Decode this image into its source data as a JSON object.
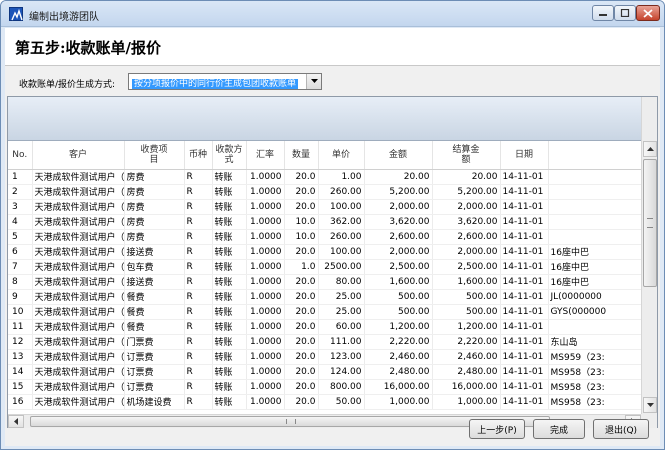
{
  "window": {
    "title": "编制出境游团队"
  },
  "header": {
    "step_title": "第五步:收款账单/报价"
  },
  "mode": {
    "label": "收款账单/报价生成方式:",
    "selected": "按分项报价中的同行价生成包团收款账单"
  },
  "table": {
    "columns": [
      "No.",
      "客户",
      "收费项目",
      "币种",
      "收款方式",
      "汇率",
      "数量",
      "单价",
      "金额",
      "结算金额",
      "日期",
      ""
    ],
    "rows": [
      [
        "1",
        "天港成软件测试用户（订阅者",
        "房费",
        "R",
        "转账",
        "1.0000",
        "20.0",
        "1.00",
        "20.00",
        "20.00",
        "14-11-01",
        ""
      ],
      [
        "2",
        "天港成软件测试用户（订阅者",
        "房费",
        "R",
        "转账",
        "1.0000",
        "20.0",
        "260.00",
        "5,200.00",
        "5,200.00",
        "14-11-01",
        ""
      ],
      [
        "3",
        "天港成软件测试用户（订阅者",
        "房费",
        "R",
        "转账",
        "1.0000",
        "20.0",
        "100.00",
        "2,000.00",
        "2,000.00",
        "14-11-01",
        ""
      ],
      [
        "4",
        "天港成软件测试用户（订阅者",
        "房费",
        "R",
        "转账",
        "1.0000",
        "10.0",
        "362.00",
        "3,620.00",
        "3,620.00",
        "14-11-01",
        ""
      ],
      [
        "5",
        "天港成软件测试用户（订阅者",
        "房费",
        "R",
        "转账",
        "1.0000",
        "10.0",
        "260.00",
        "2,600.00",
        "2,600.00",
        "14-11-01",
        ""
      ],
      [
        "6",
        "天港成软件测试用户（订阅者",
        "接送费",
        "R",
        "转账",
        "1.0000",
        "20.0",
        "100.00",
        "2,000.00",
        "2,000.00",
        "14-11-01",
        "16座中巴"
      ],
      [
        "7",
        "天港成软件测试用户（订阅者",
        "包车费",
        "R",
        "转账",
        "1.0000",
        "1.0",
        "2500.00",
        "2,500.00",
        "2,500.00",
        "14-11-01",
        "16座中巴"
      ],
      [
        "8",
        "天港成软件测试用户（订阅者",
        "接送费",
        "R",
        "转账",
        "1.0000",
        "20.0",
        "80.00",
        "1,600.00",
        "1,600.00",
        "14-11-01",
        "16座中巴"
      ],
      [
        "9",
        "天港成软件测试用户（订阅者",
        "餐费",
        "R",
        "转账",
        "1.0000",
        "20.0",
        "25.00",
        "500.00",
        "500.00",
        "14-11-01",
        "JL(0000000"
      ],
      [
        "10",
        "天港成软件测试用户（订阅者",
        "餐费",
        "R",
        "转账",
        "1.0000",
        "20.0",
        "25.00",
        "500.00",
        "500.00",
        "14-11-01",
        "GYS(000000"
      ],
      [
        "11",
        "天港成软件测试用户（订阅者",
        "餐费",
        "R",
        "转账",
        "1.0000",
        "20.0",
        "60.00",
        "1,200.00",
        "1,200.00",
        "14-11-01",
        ""
      ],
      [
        "12",
        "天港成软件测试用户（订阅者",
        "门票费",
        "R",
        "转账",
        "1.0000",
        "20.0",
        "111.00",
        "2,220.00",
        "2,220.00",
        "14-11-01",
        "东山岛"
      ],
      [
        "13",
        "天港成软件测试用户（订阅者",
        "订票费",
        "R",
        "转账",
        "1.0000",
        "20.0",
        "123.00",
        "2,460.00",
        "2,460.00",
        "14-11-01",
        "MS959（23:"
      ],
      [
        "14",
        "天港成软件测试用户（订阅者",
        "订票费",
        "R",
        "转账",
        "1.0000",
        "20.0",
        "124.00",
        "2,480.00",
        "2,480.00",
        "14-11-01",
        "MS958（23:"
      ],
      [
        "15",
        "天港成软件测试用户（订阅者",
        "订票费",
        "R",
        "转账",
        "1.0000",
        "20.0",
        "800.00",
        "16,000.00",
        "16,000.00",
        "14-11-01",
        "MS958（23:"
      ],
      [
        "16",
        "天港成软件测试用户（订阅者",
        "机场建设费",
        "R",
        "转账",
        "1.0000",
        "20.0",
        "50.00",
        "1,000.00",
        "1,000.00",
        "14-11-01",
        "MS958（23:"
      ]
    ]
  },
  "buttons": {
    "prev": "上一步(P)",
    "done": "完成",
    "exit": "退出(Q)"
  },
  "colors": {
    "selection": "#3399ff",
    "title_bar": "#c3d6ee",
    "close_button": "#c5432c"
  }
}
